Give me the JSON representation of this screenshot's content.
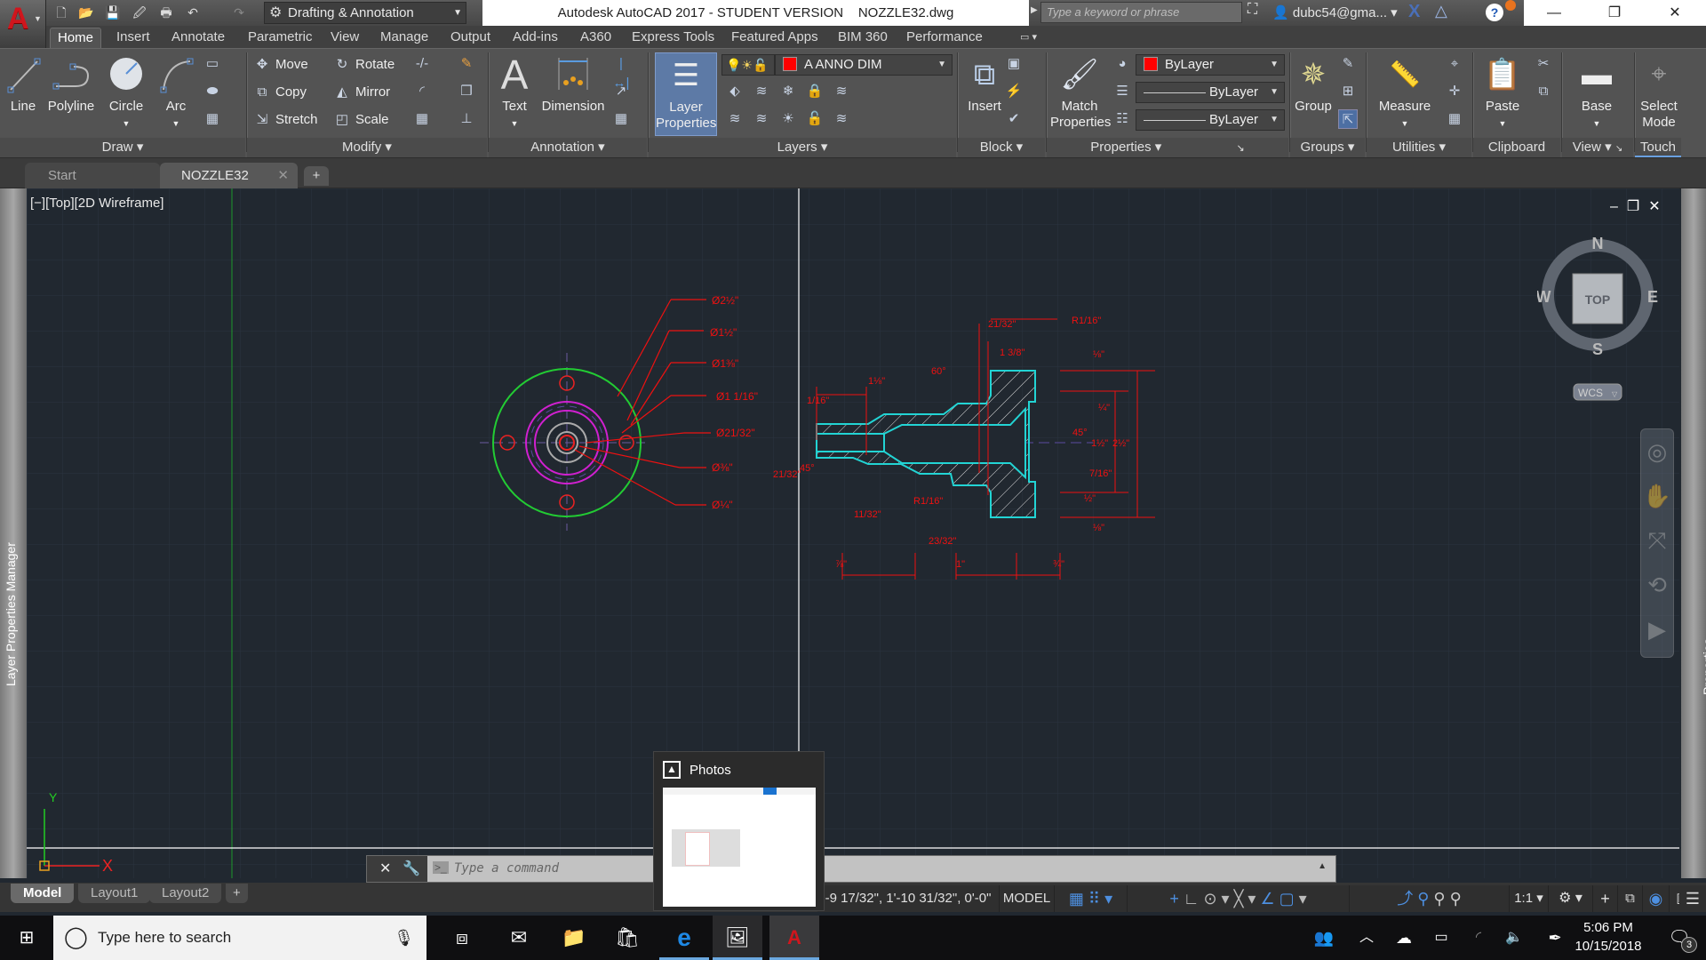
{
  "app": {
    "title": "Autodesk AutoCAD 2017 - STUDENT VERSION    NOZZLE32.dwg",
    "workspace": "Drafting & Annotation",
    "search_placeholder": "Type a keyword or phrase",
    "user": "dubc54@gma...",
    "logo_letter": "A"
  },
  "ribbon_tabs": [
    "Home",
    "Insert",
    "Annotate",
    "Parametric",
    "View",
    "Manage",
    "Output",
    "Add-ins",
    "A360",
    "Express Tools",
    "Featured Apps",
    "BIM 360",
    "Performance"
  ],
  "ribbon": {
    "draw": {
      "label": "Draw",
      "tools": [
        "Line",
        "Polyline",
        "Circle",
        "Arc"
      ]
    },
    "modify": {
      "label": "Modify",
      "tools": [
        "Move",
        "Rotate",
        "Copy",
        "Mirror",
        "Stretch",
        "Scale"
      ]
    },
    "annotation": {
      "label": "Annotation",
      "tools": [
        "Text",
        "Dimension"
      ]
    },
    "layers": {
      "label": "Layers",
      "layer_props": "Layer\nProperties",
      "layer_props_l1": "Layer",
      "layer_props_l2": "Properties",
      "current_layer": "A ANNO DIM",
      "layer_color": "#ff0000"
    },
    "block": {
      "label": "Block",
      "insert": "Insert"
    },
    "properties": {
      "label": "Properties",
      "match_l1": "Match",
      "match_l2": "Properties",
      "color": "ByLayer",
      "linetype": "ByLayer",
      "lineweight": "ByLayer"
    },
    "groups": {
      "label": "Groups",
      "group": "Group"
    },
    "utilities": {
      "label": "Utilities",
      "measure": "Measure"
    },
    "clipboard": {
      "label": "Clipboard",
      "paste": "Paste"
    },
    "view": {
      "label": "View",
      "base": "Base"
    },
    "touch": {
      "label": "Touch",
      "select_l1": "Select",
      "select_l2": "Mode"
    }
  },
  "file_tabs": [
    {
      "label": "Start"
    },
    {
      "label": "NOZZLE32",
      "active": true
    }
  ],
  "viewport": {
    "label": "[−][Top][2D Wireframe]",
    "viewcube": {
      "top": "TOP",
      "n": "N",
      "s": "S",
      "e": "E",
      "w": "W",
      "ucs": "WCS"
    },
    "ucs_y": "Y",
    "ucs_x": "X"
  },
  "drawing_dims": {
    "front_view": [
      "Ø2½\"",
      "Ø1½\"",
      "Ø1⅜\"",
      "Ø1 1/16\"",
      "Ø21/32\"",
      "Ø⅜\"",
      "Ø¼\""
    ],
    "section_view": [
      "1/16\"",
      "1⅛\"",
      "60°",
      "21/32\"",
      "1 3/8\"",
      "R1/16\"",
      "⅛\"",
      "¼\"",
      "45°",
      "1½\"",
      "2½\"",
      "7/16\"",
      "½\"",
      "⅛\"",
      "45°",
      "11/32\"",
      "R1/16\"",
      "23/32\"",
      "⅞\"",
      "1\"",
      "¾\"",
      "21/32\""
    ]
  },
  "panels": {
    "left": "Layer Properties Manager",
    "right": "Properties"
  },
  "command_line": {
    "placeholder": "Type a command"
  },
  "layout_tabs": [
    "Model",
    "Layout1",
    "Layout2"
  ],
  "status_bar": {
    "coords": "-9 17/32\", 1'-10 31/32\", 0'-0\"",
    "space": "MODEL",
    "scale": "1:1"
  },
  "photos_popup": {
    "title": "Photos"
  },
  "taskbar": {
    "search_placeholder": "Type here to search",
    "time": "5:06 PM",
    "date": "10/15/2018",
    "notifications": "3"
  }
}
